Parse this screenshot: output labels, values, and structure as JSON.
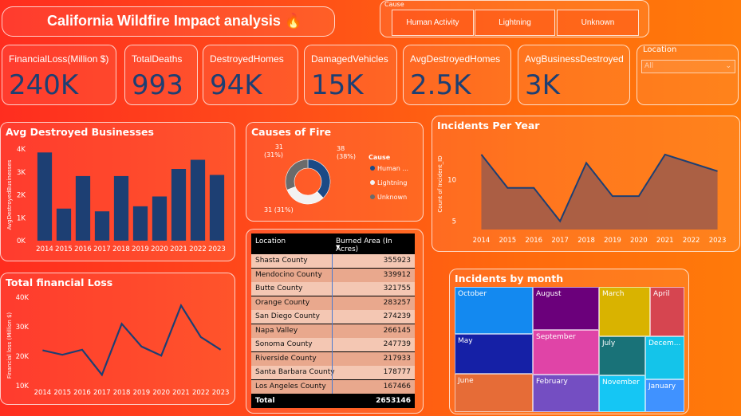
{
  "header": {
    "title": "California Wildfire Impact analysis 🔥"
  },
  "cause_slicer": {
    "label": "Cause",
    "options": [
      "Human Activity",
      "Lightning",
      "Unknown"
    ]
  },
  "kpis": [
    {
      "label": "FinancialLoss(Million $)",
      "value": "240K"
    },
    {
      "label": "TotalDeaths",
      "value": "993"
    },
    {
      "label": "DestroyedHomes",
      "value": "94K"
    },
    {
      "label": "DamagedVehicles",
      "value": "15K"
    },
    {
      "label": "AvgDestroyedHomes",
      "value": "2.5K"
    },
    {
      "label": "AvgBusinessDestroyed",
      "value": "3K"
    }
  ],
  "location_slicer": {
    "label": "Location",
    "value": "All"
  },
  "colors": {
    "navy": "#1d3f73",
    "kpi_value": "#1d3f73",
    "donut_human": "#1b4a86",
    "donut_lightning": "#f2f2f2",
    "donut_unknown": "#6b6b6b"
  },
  "chart_data": [
    {
      "id": "avg_destroyed_businesses",
      "type": "bar",
      "title": "Avg Destroyed Businesses",
      "ylabel": "AvgDestroyedBusinesses",
      "categories": [
        "2014",
        "2015",
        "2016",
        "2017",
        "2018",
        "2019",
        "2020",
        "2021",
        "2022",
        "2023"
      ],
      "values": [
        3850,
        1400,
        2820,
        1280,
        2820,
        1500,
        1930,
        3130,
        3530,
        2870
      ],
      "ylim": [
        0,
        4000
      ],
      "yticks": [
        "0K",
        "1K",
        "2K",
        "3K",
        "4K"
      ]
    },
    {
      "id": "total_financial_loss",
      "type": "line",
      "title": "Total financial Loss",
      "ylabel": "Financial loss (Million $)",
      "categories": [
        "2014",
        "2015",
        "2016",
        "2017",
        "2018",
        "2019",
        "2020",
        "2021",
        "2022",
        "2023"
      ],
      "values": [
        22000,
        20500,
        22200,
        13700,
        31000,
        23300,
        20200,
        37200,
        26500,
        22200
      ],
      "ylim": [
        10000,
        40000
      ],
      "yticks": [
        "10K",
        "20K",
        "30K",
        "40K"
      ]
    },
    {
      "id": "causes_of_fire",
      "type": "pie",
      "title": "Causes of Fire",
      "legend_title": "Cause",
      "slices": [
        {
          "name": "Human ...",
          "value": 38,
          "label": "38\n(38%)"
        },
        {
          "name": "Lightning",
          "value": 31,
          "label": "31 (31%)"
        },
        {
          "name": "Unknown",
          "value": 31,
          "label": "31\n(31%)"
        }
      ]
    },
    {
      "id": "incidents_per_year",
      "type": "area",
      "title": "Incidents Per Year",
      "ylabel": "Count of Incident_ID",
      "categories": [
        "2014",
        "2015",
        "2016",
        "2017",
        "2018",
        "2019",
        "2020",
        "2021",
        "2022",
        "2023"
      ],
      "values": [
        13,
        9,
        9,
        5,
        12,
        8,
        8,
        13,
        12,
        11
      ],
      "ylim": [
        4,
        15
      ],
      "yticks": [
        "5",
        "10"
      ]
    },
    {
      "id": "burned_area_table",
      "type": "table",
      "columns": [
        "Location",
        "Burned Area (In Acres)"
      ],
      "rows": [
        [
          "Shasta County",
          "355923"
        ],
        [
          "Mendocino County",
          "339912"
        ],
        [
          "Butte County",
          "321755"
        ],
        [
          "Orange County",
          "283257"
        ],
        [
          "San Diego County",
          "274239"
        ],
        [
          "Napa Valley",
          "266145"
        ],
        [
          "Sonoma County",
          "247739"
        ],
        [
          "Riverside County",
          "217933"
        ],
        [
          "Santa Barbara County",
          "178777"
        ],
        [
          "Los Angeles County",
          "167466"
        ]
      ],
      "total_label": "Total",
      "total_value": "2653146"
    },
    {
      "id": "incidents_by_month",
      "type": "treemap",
      "title": "Incidents by month",
      "cells": [
        {
          "name": "October",
          "color": "#1389f0"
        },
        {
          "name": "May",
          "color": "#1520a6"
        },
        {
          "name": "June",
          "color": "#e66c37"
        },
        {
          "name": "August",
          "color": "#6b007b"
        },
        {
          "name": "September",
          "color": "#e044a7"
        },
        {
          "name": "February",
          "color": "#744ec2"
        },
        {
          "name": "March",
          "color": "#d9b300"
        },
        {
          "name": "April",
          "color": "#d64550"
        },
        {
          "name": "July",
          "color": "#197278"
        },
        {
          "name": "Decem...",
          "color": "#1aab40"
        },
        {
          "name": "November",
          "color": "#15c6f4"
        },
        {
          "name": "January",
          "color": "#4092ff"
        }
      ]
    }
  ]
}
